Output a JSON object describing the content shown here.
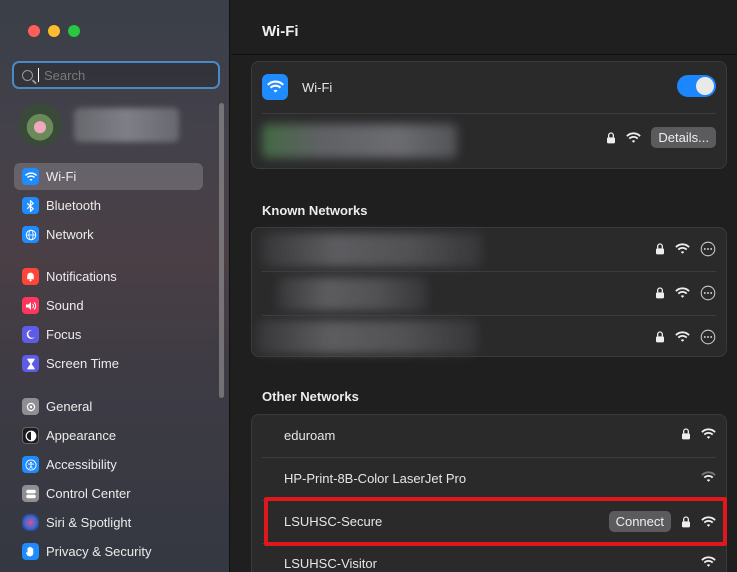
{
  "window": {
    "traffic_lights": [
      "close",
      "minimize",
      "zoom"
    ]
  },
  "search": {
    "placeholder": "Search"
  },
  "sidebar": {
    "items": [
      {
        "label": "Wi-Fi",
        "icon": "wifi-icon",
        "color": "#1e8bff",
        "selected": true
      },
      {
        "label": "Bluetooth",
        "icon": "bluetooth-icon",
        "color": "#1e8bff"
      },
      {
        "label": "Network",
        "icon": "globe-icon",
        "color": "#1e8bff"
      },
      {
        "label": "Notifications",
        "icon": "bell-icon",
        "color": "#ff453a"
      },
      {
        "label": "Sound",
        "icon": "speaker-icon",
        "color": "#ff375f"
      },
      {
        "label": "Focus",
        "icon": "moon-icon",
        "color": "#5e5ce6"
      },
      {
        "label": "Screen Time",
        "icon": "hourglass-icon",
        "color": "#5e5ce6"
      },
      {
        "label": "General",
        "icon": "gear-icon",
        "color": "#8e8e93"
      },
      {
        "label": "Appearance",
        "icon": "appearance-icon",
        "color": "#1c1c1e"
      },
      {
        "label": "Accessibility",
        "icon": "accessibility-icon",
        "color": "#1e8bff"
      },
      {
        "label": "Control Center",
        "icon": "control-center-icon",
        "color": "#8e8e93"
      },
      {
        "label": "Siri & Spotlight",
        "icon": "siri-icon",
        "color": "#6a5acd"
      },
      {
        "label": "Privacy & Security",
        "icon": "hand-icon",
        "color": "#1e8bff"
      }
    ]
  },
  "main": {
    "title": "Wi-Fi",
    "wifi_row": {
      "label": "Wi-Fi",
      "enabled": true
    },
    "current_network": {
      "details_label": "Details..."
    },
    "known_networks_title": "Known Networks",
    "other_networks_title": "Other Networks",
    "other_networks": [
      {
        "name": "eduroam",
        "locked": true,
        "connect": false
      },
      {
        "name": "HP-Print-8B-Color LaserJet Pro",
        "locked": false,
        "connect": false
      },
      {
        "name": "LSUHSC-Secure",
        "locked": true,
        "connect": true,
        "connect_label": "Connect"
      },
      {
        "name": "LSUHSC-Visitor",
        "locked": false,
        "connect": false
      }
    ],
    "highlight_color": "#e0171c"
  }
}
